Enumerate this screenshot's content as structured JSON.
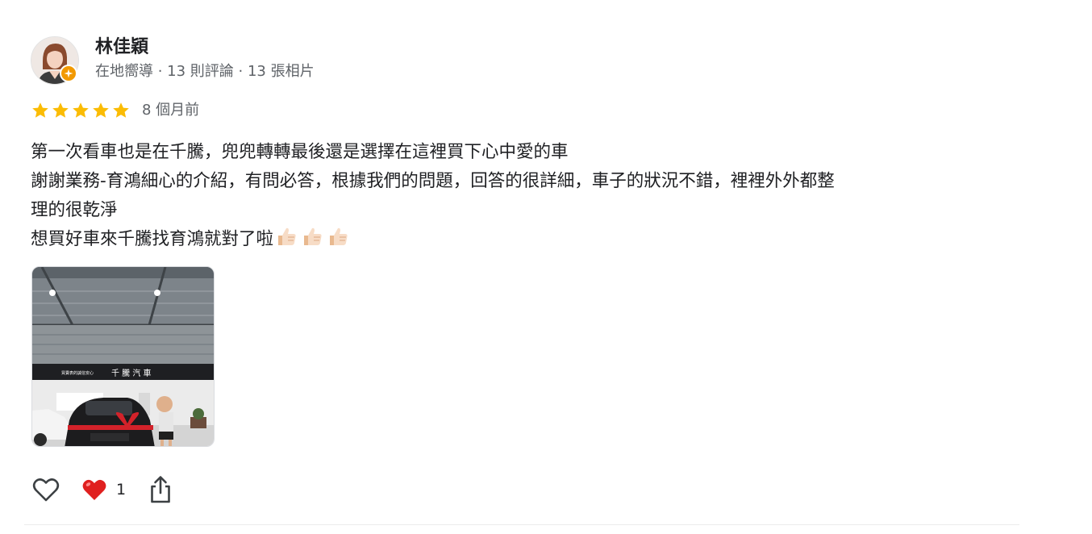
{
  "reviewer": {
    "name": "林佳穎",
    "meta": "在地嚮導 · 13 則評論 · 13 張相片",
    "avatar_icon": "profile-photo",
    "badge_icon": "local-guide-star-badge",
    "badge_color": "#f29900"
  },
  "rating": {
    "stars": 5,
    "max_stars": 5,
    "star_color": "#fbbc04",
    "date": "8 個月前"
  },
  "review": {
    "lines": [
      "第一次看車也是在千騰，兜兜轉轉最後還是選擇在這裡買下心中愛的車",
      "謝謝業務-育鴻細心的介紹，有問必答，根據我們的問題，回答的很詳細，車子的狀況不錯，裡裡外外都整",
      "理的很乾淨",
      "想買好車來千騰找育鴻就對了啦"
    ],
    "emoji": [
      "thumbs-up-emoji",
      "thumbs-up-emoji",
      "thumbs-up-emoji"
    ]
  },
  "photo": {
    "signage": "千 騰 汽 車",
    "signage_small": "買賣表的誠信安心"
  },
  "actions": {
    "like_icon": "heart-outline-icon",
    "reaction_icon": "red-heart-icon",
    "reaction_count": "1",
    "share_icon": "share-icon"
  }
}
